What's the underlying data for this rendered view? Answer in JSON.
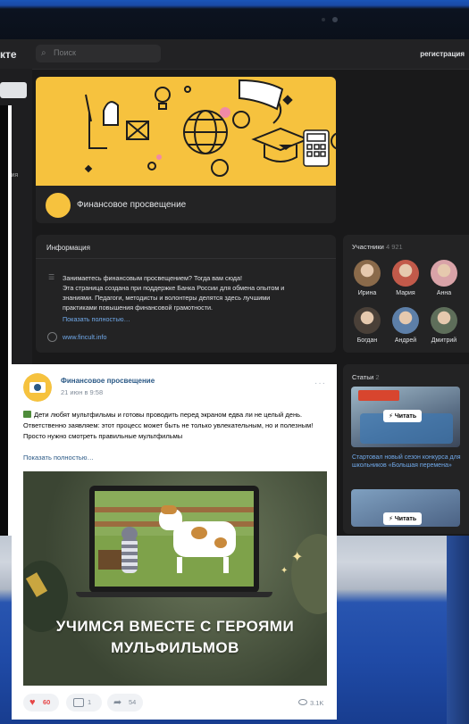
{
  "topbar": {
    "logo_fragment": "кте",
    "search_placeholder": "Поиск",
    "register_label": "регистрация"
  },
  "left_panel": {
    "cut_label": "жения"
  },
  "community": {
    "title": "Финансовое просвещение"
  },
  "info": {
    "header": "Информация",
    "text_lines": [
      "Занимаетесь финансовым просвещением? Тогда вам сюда!",
      "Эта страница создана при поддержке Банка России для обмена опытом и",
      "знаниями. Педагоги, методисты и волонтеры делятся здесь лучшими",
      "практиками повышения финансовой грамотности."
    ],
    "more": "Показать полностью…",
    "website": "www.fincult.info"
  },
  "members": {
    "header": "Участники",
    "count": "4 921",
    "list": [
      {
        "name": "Ирина",
        "color": "#8a6a4a"
      },
      {
        "name": "Мария",
        "color": "#c25a4a"
      },
      {
        "name": "Анна",
        "color": "#d9a3a8"
      },
      {
        "name": "Богдан",
        "color": "#4a4038"
      },
      {
        "name": "Андрей",
        "color": "#5d7fa8"
      },
      {
        "name": "Дмитрий",
        "color": "#5e6e5a"
      }
    ]
  },
  "articles": {
    "header": "Статьи",
    "count": "2",
    "read_label": "⚡ Читать",
    "first_title": "Стартовал новый сезон конкурса для школьников «Большая перемена»"
  },
  "post": {
    "author": "Финансовое просвещение",
    "date": "21 июн в 9:58",
    "menu": "···",
    "text": "Дети любят мультфильмы и готовы проводить перед экраном едва ли не целый день. Ответственно заявляем: этот процесс может быть не только увлекательным, но и полезным! Просто нужно смотреть правильные мультфильмы",
    "more": "Показать полностью…",
    "banner_line1": "УЧИМСЯ ВМЕСТЕ С ГЕРОЯМИ",
    "banner_line2": "МУЛЬФИЛЬМОВ",
    "likes": "60",
    "comments": "1",
    "shares": "54",
    "views": "3.1K"
  },
  "colors": {
    "vk_dark_bg": "#19191a",
    "vk_card": "#232324",
    "vk_link": "#71aaeb",
    "cover_yellow": "#f6c23e",
    "like_red": "#e64646"
  }
}
